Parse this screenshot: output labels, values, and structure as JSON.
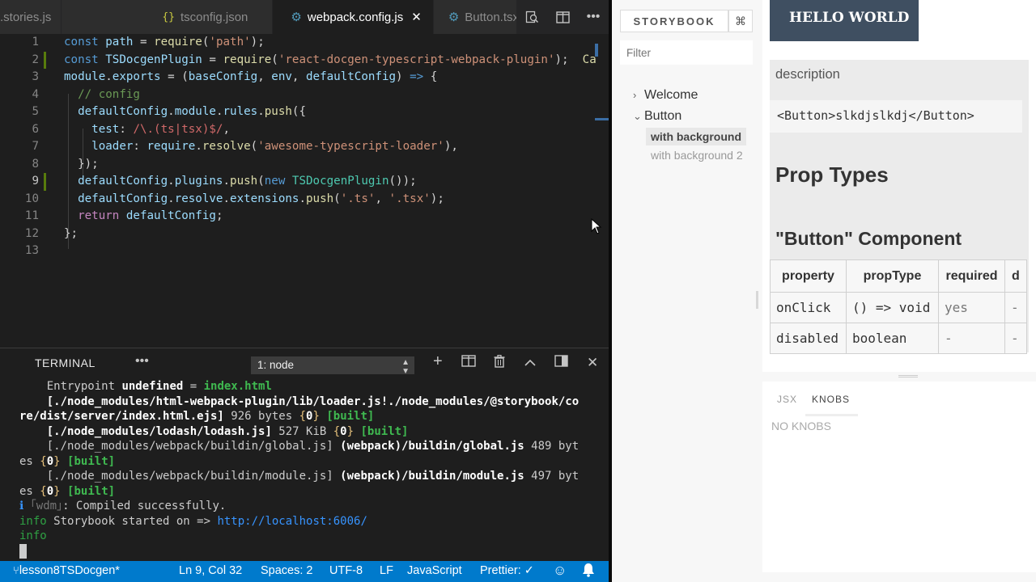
{
  "tabs": [
    {
      "label": ".stories.js",
      "icon": "",
      "active": false
    },
    {
      "label": "tsconfig.json",
      "icon": "{}",
      "active": false
    },
    {
      "label": "webpack.config.js",
      "icon": "gear-icon",
      "active": true
    },
    {
      "label": "Button.tsx",
      "icon": "gear-icon",
      "active": false
    }
  ],
  "editor": {
    "line_numbers": [
      "1",
      "2",
      "3",
      "4",
      "5",
      "6",
      "7",
      "8",
      "9",
      "10",
      "11",
      "12",
      "13"
    ],
    "overflow_text": "Ca"
  },
  "terminal": {
    "title": "TERMINAL",
    "shell_select": "1: node",
    "lines": [
      "    Entrypoint undefined = index.html",
      "    [./node_modules/html-webpack-plugin/lib/loader.js!./node_modules/@storybook/co",
      "re/dist/server/index.html.ejs] 926 bytes {0} [built]",
      "    [./node_modules/lodash/lodash.js] 527 KiB {0} [built]",
      "    [./node_modules/webpack/buildin/global.js] (webpack)/buildin/global.js 489 byt",
      "es {0} [built]",
      "    [./node_modules/webpack/buildin/module.js] (webpack)/buildin/module.js 497 byt",
      "es {0} [built]",
      "ℹ ｢wdm｣: Compiled successfully.",
      "info Storybook started on => http://localhost:6006/",
      "info"
    ]
  },
  "statusbar": {
    "branch": "lesson8TSDocgen*",
    "position": "Ln 9, Col 32",
    "spaces": "Spaces: 2",
    "encoding": "UTF-8",
    "eol": "LF",
    "language": "JavaScript",
    "prettier": "Prettier: ✓"
  },
  "storybook": {
    "brand": "STORYBOOK",
    "shortcut_icon": "⌘",
    "filter_placeholder": "Filter",
    "nav": [
      {
        "label": "Welcome",
        "expanded": false
      },
      {
        "label": "Button",
        "expanded": true
      }
    ],
    "stories": [
      {
        "label": "with background",
        "selected": true
      },
      {
        "label": "with background 2",
        "selected": false
      }
    ],
    "preview": {
      "button_text": "HELLO WORLD",
      "description_label": "description",
      "code_example": "<Button>slkdjslkdj</Button>",
      "prop_types_heading": "Prop Types",
      "component_heading": "\"Button\" Component",
      "table_headers": [
        "property",
        "propType",
        "required",
        "d"
      ],
      "table_rows": [
        [
          "onClick",
          "() => void",
          "yes",
          "-"
        ],
        [
          "disabled",
          "boolean",
          "-",
          "-"
        ]
      ]
    },
    "addon_tabs": [
      "JSX",
      "KNOBS"
    ],
    "active_addon_tab": "KNOBS",
    "no_knobs": "NO KNOBS"
  },
  "colors": {
    "status_bar": "#007acc",
    "hello_button": "#3f4f61",
    "editor_bg": "#1e1e1e"
  }
}
